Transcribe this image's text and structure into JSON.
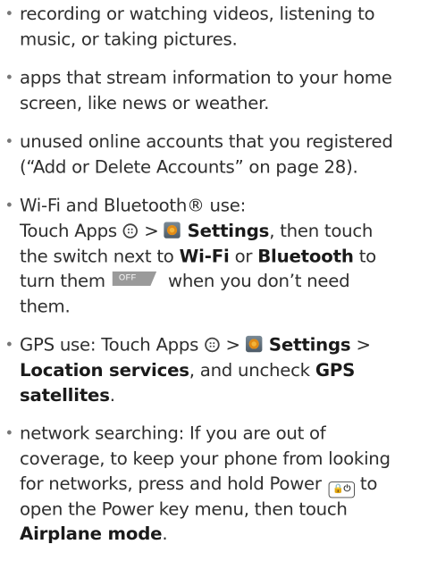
{
  "items": [
    {
      "text": "recording or watching videos, listening to music, or taking pictures."
    },
    {
      "text": "apps that stream information to your home screen, like news or weather."
    },
    {
      "text": "unused online accounts that you registered (“Add or Delete Accounts” on page 28)."
    },
    {
      "part1": "Wi-Fi and Bluetooth® use:",
      "part2": "Touch Apps",
      "part3": ">",
      "settings": "Settings",
      "part4": ", then touch the switch next to",
      "wifi": "Wi-Fi",
      "or": "or",
      "bluetooth": "Bluetooth",
      "part5": "to turn them",
      "off_label": "OFF",
      "part6": "when you don’t need them."
    },
    {
      "part1": "GPS use: Touch Apps",
      "part2": ">",
      "settings": "Settings",
      "part3": ">",
      "location": "Location services",
      "part4": ", and uncheck",
      "gps": "GPS satellites",
      "part5": "."
    },
    {
      "part1": "network searching: If you are out of coverage, to keep your phone from looking for networks, press and hold Power",
      "power_icon": "🔒⏻",
      "part2": "to open the Power key menu, then touch",
      "airplane": "Airplane mode",
      "part3": "."
    }
  ],
  "icons": {
    "apps": "apps-icon",
    "settings": "settings-icon",
    "power": "power-icon",
    "off_switch": "off-switch-icon"
  }
}
